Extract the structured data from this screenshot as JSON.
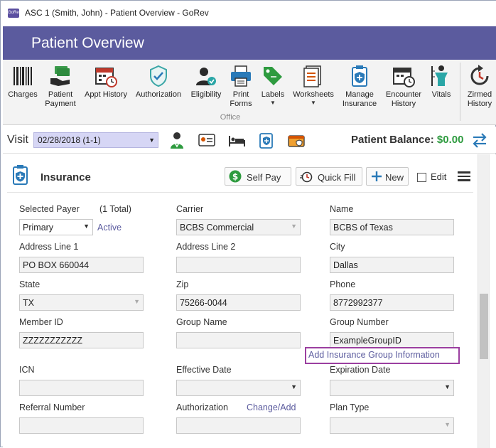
{
  "window": {
    "title": "ASC 1 (Smith, John) - Patient Overview - GoRev",
    "app_icon_text": "GoRev"
  },
  "header": {
    "title": "Patient Overview"
  },
  "ribbon": {
    "group_label": "Office",
    "buttons": [
      {
        "label": "Charges"
      },
      {
        "label": "Patient\nPayment"
      },
      {
        "label": "Appt History"
      },
      {
        "label": "Authorization"
      },
      {
        "label": "Eligibility"
      },
      {
        "label": "Print\nForms"
      },
      {
        "label": "Labels",
        "dropdown": "▼"
      },
      {
        "label": "Worksheets",
        "dropdown": "▼"
      },
      {
        "label": "Manage\nInsurance"
      },
      {
        "label": "Encounter\nHistory"
      },
      {
        "label": "Vitals"
      },
      {
        "label": "Zirmed\nHistory"
      }
    ]
  },
  "visit": {
    "label": "Visit",
    "selected": "02/28/2018 (1-1)",
    "dropdown_arrow": "▼",
    "balance_label": "Patient Balance:",
    "balance_amount": "$0.00"
  },
  "insurance": {
    "title": "Insurance",
    "self_pay": "Self Pay",
    "quick_fill": "Quick Fill",
    "new": "New",
    "edit": "Edit",
    "fields": {
      "selected_payer_label": "Selected Payer",
      "total": "(1 Total)",
      "payer_value": "Primary",
      "payer_status": "Active",
      "carrier_label": "Carrier",
      "carrier_value": "BCBS Commercial",
      "name_label": "Name",
      "name_value": "BCBS of Texas",
      "address1_label": "Address Line 1",
      "address1_value": "PO BOX 660044",
      "address2_label": "Address Line 2",
      "address2_value": "",
      "city_label": "City",
      "city_value": "Dallas",
      "state_label": "State",
      "state_value": "TX",
      "zip_label": "Zip",
      "zip_value": "75266-0044",
      "phone_label": "Phone",
      "phone_value": "8772992377",
      "member_id_label": "Member ID",
      "member_id_value": "ZZZZZZZZZZZ",
      "group_name_label": "Group Name",
      "group_name_value": "",
      "group_number_label": "Group Number",
      "group_number_value": "ExampleGroupID",
      "add_group_link": "Add Insurance Group Information",
      "icn_label": "ICN",
      "icn_value": "",
      "effective_date_label": "Effective Date",
      "effective_date_value": "",
      "expiration_date_label": "Expiration Date",
      "expiration_date_value": "",
      "referral_label": "Referral Number",
      "referral_value": "",
      "authorization_label": "Authorization",
      "authorization_link": "Change/Add",
      "authorization_value": "",
      "plan_type_label": "Plan Type",
      "plan_type_value": ""
    }
  },
  "colors": {
    "header": "#5b5b9e",
    "accent": "#5b5b9e",
    "balance": "#2e9b3f",
    "highlight_box": "#9b3fa0",
    "visit_select": "#d6d6f5"
  }
}
